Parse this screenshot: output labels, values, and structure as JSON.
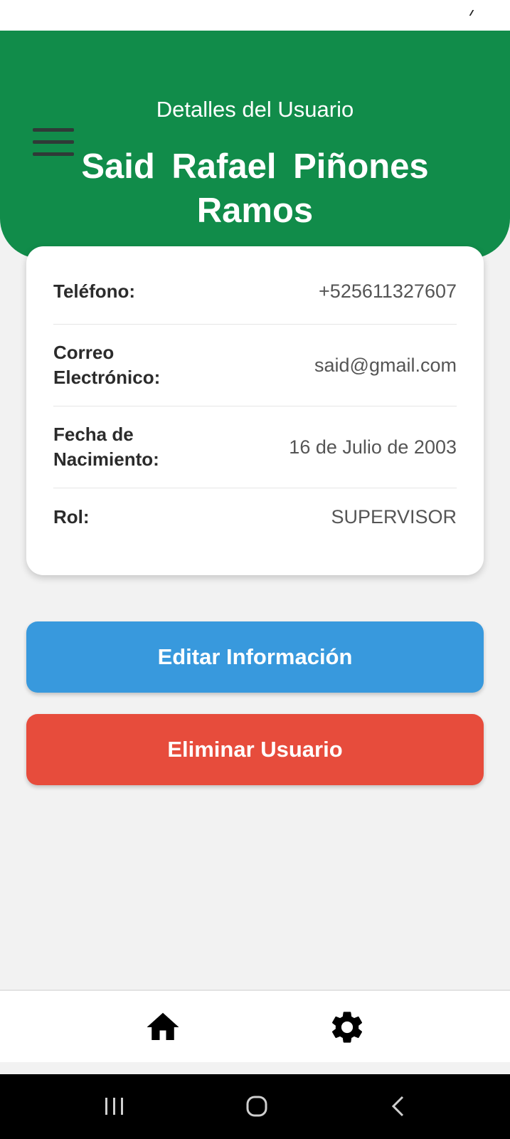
{
  "header": {
    "subtitle": "Detalles del Usuario",
    "user_name": "Said  Rafael  Piñones Ramos",
    "menu_icon": "hamburger-menu-icon"
  },
  "details": [
    {
      "label": "Teléfono:",
      "value": "+525611327607"
    },
    {
      "label": "Correo Electrónico:",
      "value": "said@gmail.com"
    },
    {
      "label": "Fecha de Nacimiento:",
      "value": "16 de Julio de 2003"
    },
    {
      "label": "Rol:",
      "value": "SUPERVISOR"
    }
  ],
  "actions": {
    "edit_label": "Editar Información",
    "delete_label": "Eliminar Usuario"
  },
  "bottom_nav": {
    "items": [
      {
        "icon": "home-icon"
      },
      {
        "icon": "gear-icon"
      }
    ]
  },
  "system_nav": {
    "items": [
      "recent-apps-icon",
      "home-circle-icon",
      "back-icon"
    ]
  },
  "colors": {
    "header": "#118c4a",
    "edit_button": "#3899dd",
    "delete_button": "#e74c3c",
    "background": "#f2f2f2"
  }
}
